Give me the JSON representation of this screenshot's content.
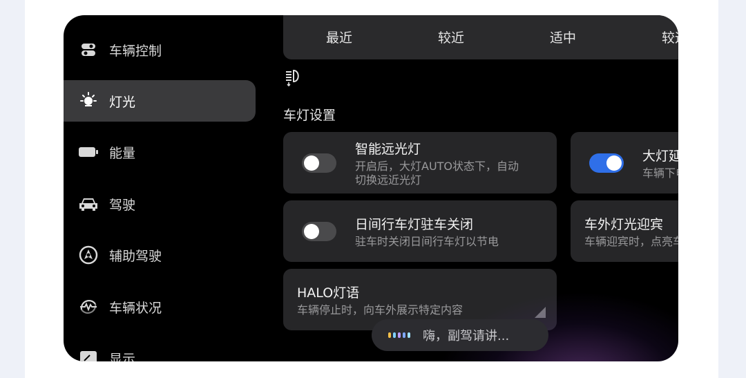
{
  "sidebar": {
    "items": [
      {
        "label": "车辆控制",
        "icon": "toggle-switches-icon"
      },
      {
        "label": "灯光",
        "icon": "light-bulb-icon",
        "active": true
      },
      {
        "label": "能量",
        "icon": "battery-icon"
      },
      {
        "label": "驾驶",
        "icon": "car-icon"
      },
      {
        "label": "辅助驾驶",
        "icon": "steering-wheel-icon"
      },
      {
        "label": "车辆状况",
        "icon": "heart-rate-icon"
      },
      {
        "label": "显示",
        "icon": "display-icon"
      }
    ]
  },
  "distance_options": [
    "最近",
    "较近",
    "适中",
    "较远"
  ],
  "section_title": "车灯设置",
  "cards": {
    "smart_high_beam": {
      "title": "智能远光灯",
      "subtitle_line1": "开启后，大灯AUTO状态下，自动",
      "subtitle_line2": "切换远近光灯",
      "enabled": false
    },
    "headlight_delay": {
      "title": "大灯延时关闭",
      "subtitle": "车辆下电后大灯延时关闭",
      "enabled": true
    },
    "drl_park_off": {
      "title": "日间行车灯驻车关闭",
      "subtitle": "驻车时关闭日间行车灯以节电",
      "enabled": false
    },
    "welcome_light": {
      "title": "车外灯光迎宾",
      "subtitle": "车辆迎宾时，点亮车外灯光"
    },
    "halo": {
      "title": "HALO灯语",
      "subtitle": "车辆停止时，向车外展示特定内容"
    }
  },
  "voice": {
    "prompt": "嗨，副驾请讲..."
  },
  "colors": {
    "accent": "#2f6fe8",
    "card": "#262628",
    "sidebar_active": "#3a3a3c",
    "background": "#000000"
  }
}
